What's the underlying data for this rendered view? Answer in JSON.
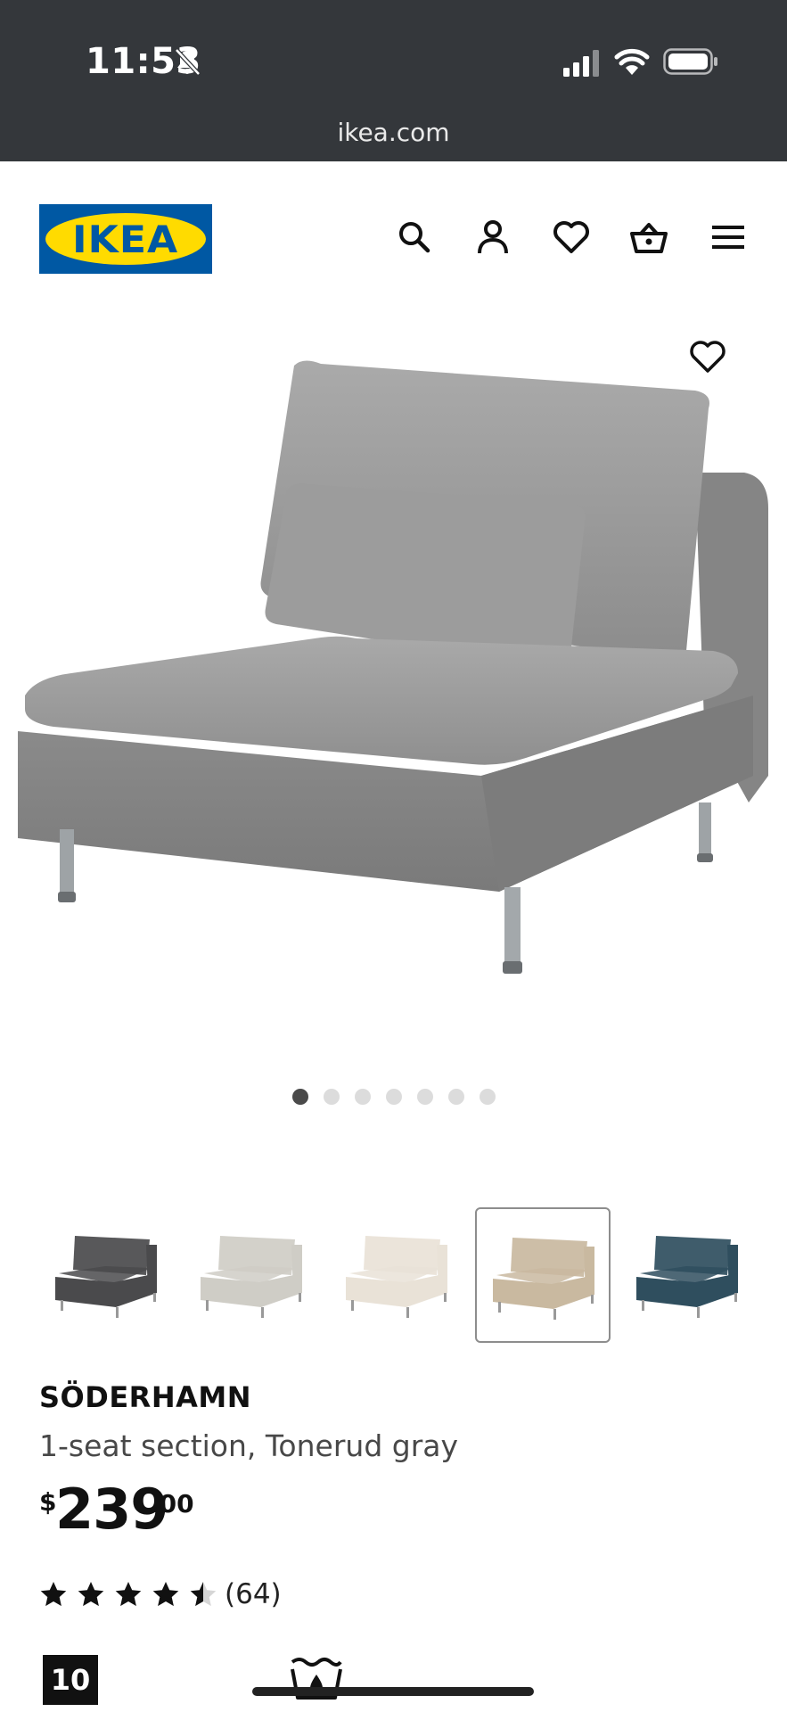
{
  "status_bar": {
    "time": "11:53",
    "url": "ikea.com"
  },
  "header": {
    "logo_text": "IKEA",
    "icons": [
      "search-icon",
      "account-icon",
      "favorites-icon",
      "cart-icon",
      "menu-icon"
    ]
  },
  "gallery": {
    "image_count": 7,
    "active_index": 0
  },
  "swatches": [
    {
      "name": "dark-gray",
      "color": "#4a4a4c",
      "selected": false
    },
    {
      "name": "light-gray",
      "color": "#cfcdc6",
      "selected": false
    },
    {
      "name": "off-white",
      "color": "#e9e2d7",
      "selected": false
    },
    {
      "name": "beige",
      "color": "#c9b9a0",
      "selected": true
    },
    {
      "name": "blue",
      "color": "#2f4e5e",
      "selected": false
    }
  ],
  "product": {
    "name": "SÖDERHAMN",
    "description": "1-seat section, Tonerud gray",
    "price_currency": "$",
    "price_main": "239",
    "price_decimal": ".00",
    "rating": 4.5,
    "rating_max": 5,
    "review_count": "(64)",
    "badge": "10"
  },
  "colors": {
    "status_bg": "#34373b",
    "ikea_blue": "#0058a3",
    "ikea_yellow": "#ffdb00"
  }
}
